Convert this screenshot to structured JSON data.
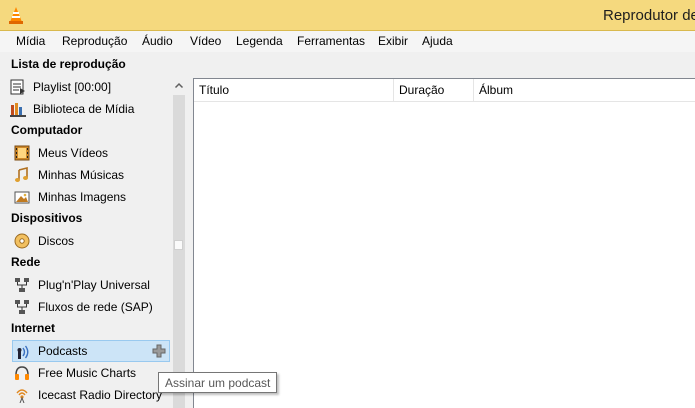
{
  "window": {
    "title": "Reprodutor de"
  },
  "menu": [
    "Mídia",
    "Reprodução",
    "Áudio",
    "Vídeo",
    "Legenda",
    "Ferramentas",
    "Exibir",
    "Ajuda"
  ],
  "sidebar": {
    "sections": [
      {
        "header": "Lista de reprodução",
        "items": [
          {
            "label": "Playlist [00:00]",
            "icon": "playlist-icon"
          },
          {
            "label": "Biblioteca de Mídia",
            "icon": "media-library-icon"
          }
        ]
      },
      {
        "header": "Computador",
        "items": [
          {
            "label": "Meus Vídeos",
            "icon": "video-film-icon"
          },
          {
            "label": "Minhas Músicas",
            "icon": "music-note-icon"
          },
          {
            "label": "Minhas Imagens",
            "icon": "picture-icon"
          }
        ]
      },
      {
        "header": "Dispositivos",
        "items": [
          {
            "label": "Discos",
            "icon": "disc-icon"
          }
        ]
      },
      {
        "header": "Rede",
        "items": [
          {
            "label": "Plug'n'Play Universal",
            "icon": "network-icon"
          },
          {
            "label": "Fluxos de rede (SAP)",
            "icon": "network-icon"
          }
        ]
      },
      {
        "header": "Internet",
        "items": [
          {
            "label": "Podcasts",
            "icon": "podcast-icon",
            "selected": true
          },
          {
            "label": "Free Music Charts",
            "icon": "music-charts-icon"
          },
          {
            "label": "Icecast Radio Directory",
            "icon": "radio-icon"
          }
        ]
      }
    ]
  },
  "table": {
    "columns": [
      "Título",
      "Duração",
      "Álbum"
    ]
  },
  "tooltip": {
    "text": "Assinar um podcast"
  },
  "colors": {
    "titlebar": "#f5d97e",
    "selection": "#cce4f7",
    "accent_orange": "#ff8800"
  }
}
